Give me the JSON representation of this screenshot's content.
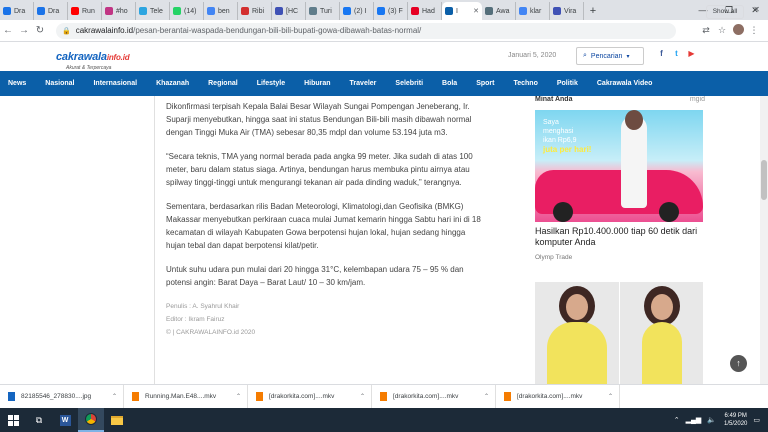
{
  "browser": {
    "tabs": [
      {
        "label": "Dra",
        "color": "#1a73e8"
      },
      {
        "label": "Dra",
        "color": "#1a73e8"
      },
      {
        "label": "Run",
        "color": "#ff0000"
      },
      {
        "label": "#ho",
        "color": "#c13584"
      },
      {
        "label": "Tele",
        "color": "#2ca5e0"
      },
      {
        "label": "(14)",
        "color": "#25d366"
      },
      {
        "label": "ben",
        "color": "#4285f4"
      },
      {
        "label": "Ribi",
        "color": "#d32f2f"
      },
      {
        "label": "[HC",
        "color": "#3f51b5"
      },
      {
        "label": "Turi",
        "color": "#607d8b"
      },
      {
        "label": "(2) I",
        "color": "#1877f2"
      },
      {
        "label": "(3) F",
        "color": "#1877f2"
      },
      {
        "label": "Had",
        "color": "#e60023"
      },
      {
        "label": "I",
        "color": "#0b5fa8",
        "active": true
      },
      {
        "label": "Awa",
        "color": "#546e7a"
      },
      {
        "label": "klar",
        "color": "#4285f4"
      },
      {
        "label": "Vira",
        "color": "#3f51b5"
      }
    ],
    "new_tab": "+",
    "window_controls": [
      "—",
      "❐",
      "✕"
    ],
    "url_domain": "cakrawalainfo.id",
    "url_path": "/pesan-berantai-waspada-bendungan-bili-bili-bupati-gowa-dibawah-batas-normal/"
  },
  "site": {
    "logo_main": "cakrawala",
    "logo_domain": "info.id",
    "logo_tagline": "Akurat & Terpercaya",
    "date": "Januari 5, 2020",
    "search_label": "Pencarian",
    "social": [
      {
        "icon": "facebook-icon",
        "glyph": "f",
        "color": "#3b5998"
      },
      {
        "icon": "twitter-icon",
        "glyph": "t",
        "color": "#1da1f2"
      },
      {
        "icon": "youtube-icon",
        "glyph": "▶",
        "color": "#e53935"
      }
    ],
    "nav": [
      "News",
      "Nasional",
      "Internasional",
      "Khazanah",
      "Regional",
      "Lifestyle",
      "Hiburan",
      "Traveler",
      "Selebriti",
      "Bola",
      "Sport",
      "Techno",
      "Politik",
      "Cakrawala Video"
    ]
  },
  "article": {
    "paragraphs": [
      "Dikonfirmasi terpisah Kepala Balai Besar Wilayah Sungai Pompengan Jeneberang, Ir. Suparji menyebutkan, hingga saat ini status Bendungan Bili-bili masih dibawah normal dengan Tinggi Muka Air (TMA) sebesar 80,35 mdpl dan volume 53.194 juta m3.",
      "“Secara teknis, TMA yang normal berada pada angka 99 meter. Jika sudah di atas 100 meter, baru dalam status siaga. Artinya, bendungan harus membuka pintu airnya atau spilway tinggi-tinggi untuk mengurangi tekanan air pada dinding waduk,” terangnya.",
      "Sementara, berdasarkan rilis Badan Meteorologi, Klimatologi,dan Geofisika (BMKG) Makassar menyebutkan perkiraan cuaca mulai Jumat kemarin hingga Sabtu hari ini di 18 kecamatan di wilayah Kabupaten Gowa berpotensi hujan lokal, hujan sedang hingga hujan tebal dan dapat berpotensi kilat/petir.",
      "Untuk suhu udara pun mulai dari 20 hingga 31°C, kelembapan udara 75 – 95 % dan potensi angin: Barat Daya – Barat Laut/ 10 – 30 km/jam."
    ],
    "writer": "Penulis  : A. Syahrul Khair",
    "editor": "Editor   : Ikram Fairuz",
    "copyright": "© | CAKRAWALAINFO.id 2020"
  },
  "sidebar": {
    "heading": "Minat Anda",
    "mgid": "mgid",
    "ad1_line1": "Saya",
    "ad1_line2": "menghasi",
    "ad1_line3": "ikan Rp6,9",
    "ad1_line4": "juta per hari!",
    "ad1_title": "Hasilkan Rp10.400.000 tiap 60 detik dari komputer Anda",
    "ad1_source": "Olymp Trade"
  },
  "downloads": {
    "items": [
      {
        "name": "82185546_278830....jpg",
        "color": "#1565c0"
      },
      {
        "name": "Running.Man.E48....mkv",
        "color": "#f57c00"
      },
      {
        "name": "[drakorkita.com]....mkv",
        "color": "#f57c00"
      },
      {
        "name": "[drakorkita.com]....mkv",
        "color": "#f57c00"
      },
      {
        "name": "[drakorkita.com]....mkv",
        "color": "#f57c00"
      }
    ],
    "show_all": "Show all"
  },
  "taskbar": {
    "time": "6:49 PM",
    "date": "1/5/2020"
  }
}
